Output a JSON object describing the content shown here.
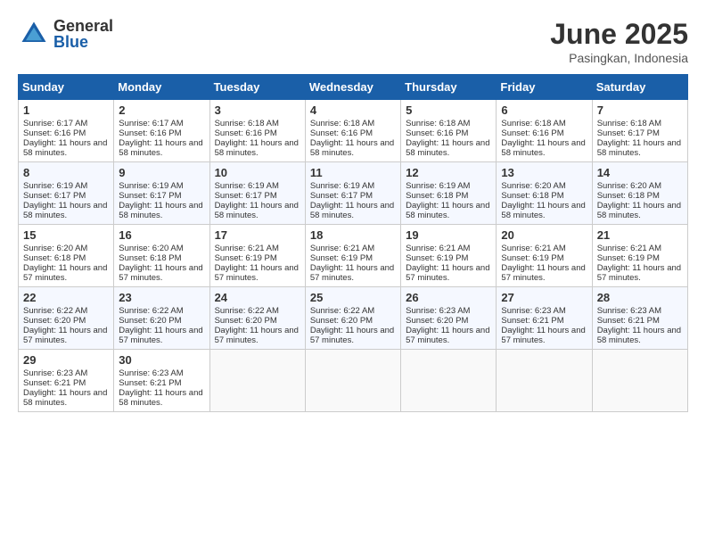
{
  "logo": {
    "general": "General",
    "blue": "Blue"
  },
  "title": "June 2025",
  "location": "Pasingkan, Indonesia",
  "days": [
    "Sunday",
    "Monday",
    "Tuesday",
    "Wednesday",
    "Thursday",
    "Friday",
    "Saturday"
  ],
  "weeks": [
    [
      {
        "day": "1",
        "sunrise": "6:17 AM",
        "sunset": "6:16 PM",
        "daylight": "11 hours and 58 minutes."
      },
      {
        "day": "2",
        "sunrise": "6:17 AM",
        "sunset": "6:16 PM",
        "daylight": "11 hours and 58 minutes."
      },
      {
        "day": "3",
        "sunrise": "6:18 AM",
        "sunset": "6:16 PM",
        "daylight": "11 hours and 58 minutes."
      },
      {
        "day": "4",
        "sunrise": "6:18 AM",
        "sunset": "6:16 PM",
        "daylight": "11 hours and 58 minutes."
      },
      {
        "day": "5",
        "sunrise": "6:18 AM",
        "sunset": "6:16 PM",
        "daylight": "11 hours and 58 minutes."
      },
      {
        "day": "6",
        "sunrise": "6:18 AM",
        "sunset": "6:16 PM",
        "daylight": "11 hours and 58 minutes."
      },
      {
        "day": "7",
        "sunrise": "6:18 AM",
        "sunset": "6:17 PM",
        "daylight": "11 hours and 58 minutes."
      }
    ],
    [
      {
        "day": "8",
        "sunrise": "6:19 AM",
        "sunset": "6:17 PM",
        "daylight": "11 hours and 58 minutes."
      },
      {
        "day": "9",
        "sunrise": "6:19 AM",
        "sunset": "6:17 PM",
        "daylight": "11 hours and 58 minutes."
      },
      {
        "day": "10",
        "sunrise": "6:19 AM",
        "sunset": "6:17 PM",
        "daylight": "11 hours and 58 minutes."
      },
      {
        "day": "11",
        "sunrise": "6:19 AM",
        "sunset": "6:17 PM",
        "daylight": "11 hours and 58 minutes."
      },
      {
        "day": "12",
        "sunrise": "6:19 AM",
        "sunset": "6:18 PM",
        "daylight": "11 hours and 58 minutes."
      },
      {
        "day": "13",
        "sunrise": "6:20 AM",
        "sunset": "6:18 PM",
        "daylight": "11 hours and 58 minutes."
      },
      {
        "day": "14",
        "sunrise": "6:20 AM",
        "sunset": "6:18 PM",
        "daylight": "11 hours and 58 minutes."
      }
    ],
    [
      {
        "day": "15",
        "sunrise": "6:20 AM",
        "sunset": "6:18 PM",
        "daylight": "11 hours and 57 minutes."
      },
      {
        "day": "16",
        "sunrise": "6:20 AM",
        "sunset": "6:18 PM",
        "daylight": "11 hours and 57 minutes."
      },
      {
        "day": "17",
        "sunrise": "6:21 AM",
        "sunset": "6:19 PM",
        "daylight": "11 hours and 57 minutes."
      },
      {
        "day": "18",
        "sunrise": "6:21 AM",
        "sunset": "6:19 PM",
        "daylight": "11 hours and 57 minutes."
      },
      {
        "day": "19",
        "sunrise": "6:21 AM",
        "sunset": "6:19 PM",
        "daylight": "11 hours and 57 minutes."
      },
      {
        "day": "20",
        "sunrise": "6:21 AM",
        "sunset": "6:19 PM",
        "daylight": "11 hours and 57 minutes."
      },
      {
        "day": "21",
        "sunrise": "6:21 AM",
        "sunset": "6:19 PM",
        "daylight": "11 hours and 57 minutes."
      }
    ],
    [
      {
        "day": "22",
        "sunrise": "6:22 AM",
        "sunset": "6:20 PM",
        "daylight": "11 hours and 57 minutes."
      },
      {
        "day": "23",
        "sunrise": "6:22 AM",
        "sunset": "6:20 PM",
        "daylight": "11 hours and 57 minutes."
      },
      {
        "day": "24",
        "sunrise": "6:22 AM",
        "sunset": "6:20 PM",
        "daylight": "11 hours and 57 minutes."
      },
      {
        "day": "25",
        "sunrise": "6:22 AM",
        "sunset": "6:20 PM",
        "daylight": "11 hours and 57 minutes."
      },
      {
        "day": "26",
        "sunrise": "6:23 AM",
        "sunset": "6:20 PM",
        "daylight": "11 hours and 57 minutes."
      },
      {
        "day": "27",
        "sunrise": "6:23 AM",
        "sunset": "6:21 PM",
        "daylight": "11 hours and 57 minutes."
      },
      {
        "day": "28",
        "sunrise": "6:23 AM",
        "sunset": "6:21 PM",
        "daylight": "11 hours and 58 minutes."
      }
    ],
    [
      {
        "day": "29",
        "sunrise": "6:23 AM",
        "sunset": "6:21 PM",
        "daylight": "11 hours and 58 minutes."
      },
      {
        "day": "30",
        "sunrise": "6:23 AM",
        "sunset": "6:21 PM",
        "daylight": "11 hours and 58 minutes."
      },
      null,
      null,
      null,
      null,
      null
    ]
  ]
}
